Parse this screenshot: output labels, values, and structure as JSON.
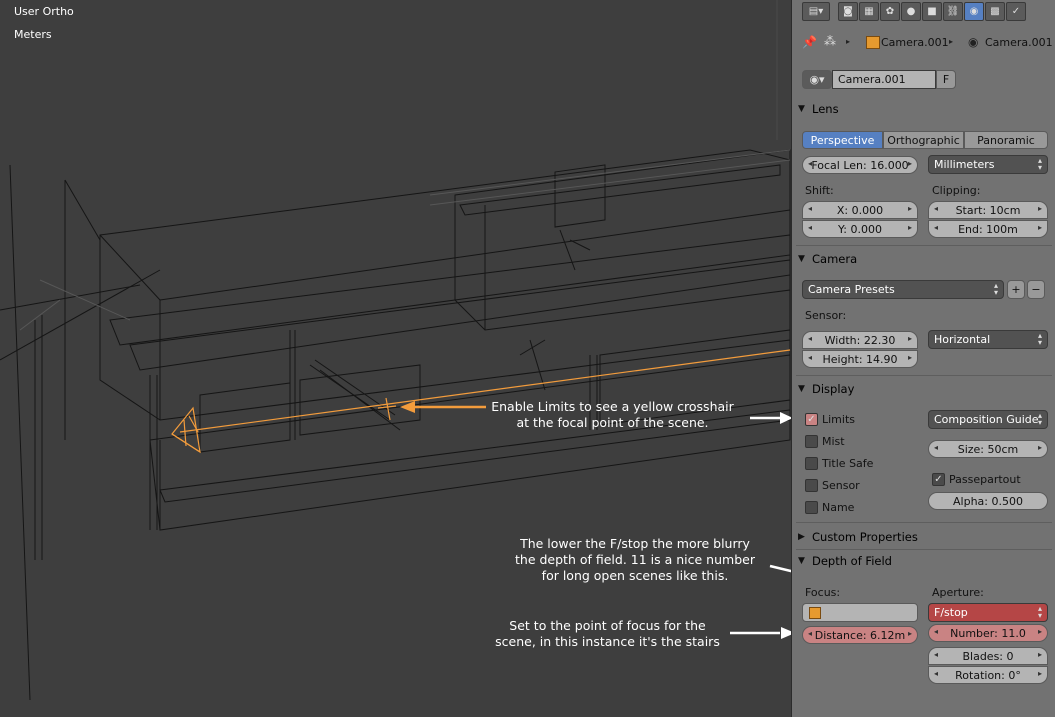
{
  "viewport": {
    "view_name": "User Ortho",
    "units": "Meters",
    "annotations": {
      "limits_line1": "Enable Limits to see a yellow crosshair",
      "limits_line2": "at the focal point of the scene.",
      "fstop_line1": "The lower the F/stop the more blurry",
      "fstop_line2": "the depth of field. 11 is a nice number",
      "fstop_line3": "for long open scenes like this.",
      "focus_line1": "Set to the point of focus for the",
      "focus_line2": "scene, in this instance it's the stairs"
    }
  },
  "properties": {
    "breadcrumb": {
      "object": "Camera.001",
      "data": "Camera.001"
    },
    "datablock": {
      "name": "Camera.001",
      "fake_user": "F"
    },
    "lens": {
      "title": "Lens",
      "tabs": [
        "Perspective",
        "Orthographic",
        "Panoramic"
      ],
      "active_tab": "Perspective",
      "focal_len": "Focal Len: 16.000",
      "units": "Millimeters",
      "shift_label": "Shift:",
      "shift_x": "X: 0.000",
      "shift_y": "Y: 0.000",
      "clipping_label": "Clipping:",
      "clip_start": "Start: 10cm",
      "clip_end": "End: 100m"
    },
    "camera": {
      "title": "Camera",
      "presets": "Camera Presets",
      "add": "+",
      "remove": "−",
      "sensor_label": "Sensor:",
      "width": "Width: 22.30",
      "height": "Height: 14.90",
      "fit": "Horizontal"
    },
    "display": {
      "title": "Display",
      "limits": "Limits",
      "mist": "Mist",
      "title_safe": "Title Safe",
      "sensor": "Sensor",
      "name": "Name",
      "composition_guide": "Composition Guide",
      "size": "Size: 50cm",
      "passepartout": "Passepartout",
      "alpha": "Alpha: 0.500"
    },
    "custom_properties": {
      "title": "Custom Properties"
    },
    "dof": {
      "title": "Depth of Field",
      "focus_label": "Focus:",
      "distance": "Distance: 6.12m",
      "aperture_label": "Aperture:",
      "aperture_type": "F/stop",
      "number": "Number: 11.0",
      "blades": "Blades: 0",
      "rotation": "Rotation: 0°"
    }
  }
}
